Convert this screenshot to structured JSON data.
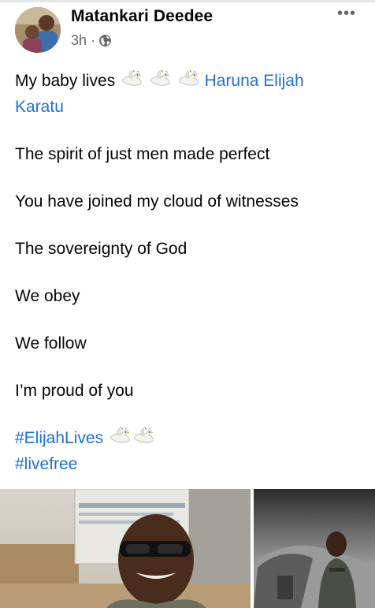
{
  "post": {
    "author": "Matankari Deedee",
    "time": "3h",
    "separator": "·",
    "privacy_icon": "globe-icon",
    "more_icon": "more-dots-icon",
    "more_label": "•••",
    "first_line_text": "My baby lives",
    "tagged_user_line1": "Haruna Elijah",
    "tagged_user_line2": "Karatu",
    "lines": [
      "The spirit of just men made perfect",
      "You have joined my cloud of witnesses",
      "The sovereignty of God",
      "We obey",
      "We follow",
      "I’m proud of you"
    ],
    "hashtags": [
      "#ElijahLives",
      "#livefree"
    ],
    "emoji": "dove-emoji",
    "link_color": "#216fdb",
    "meta_color": "#65676b"
  },
  "photos": [
    {
      "name": "photo-man-sunglasses"
    },
    {
      "name": "photo-pilot-jet"
    }
  ]
}
